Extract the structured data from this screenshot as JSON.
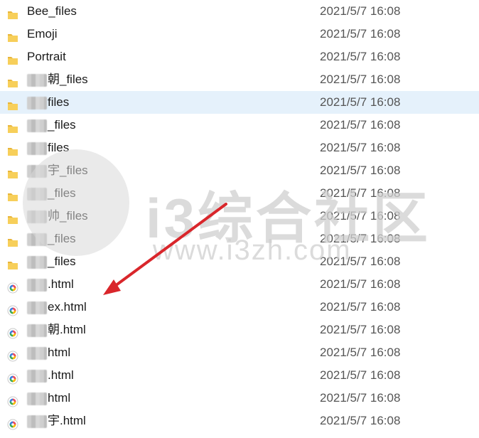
{
  "files": [
    {
      "type": "folder",
      "prefix_mask": 0,
      "name": "Bee_files",
      "date": "2021/5/7 16:08"
    },
    {
      "type": "folder",
      "prefix_mask": 0,
      "name": "Emoji",
      "date": "2021/5/7 16:08"
    },
    {
      "type": "folder",
      "prefix_mask": 0,
      "name": "Portrait",
      "date": "2021/5/7 16:08"
    },
    {
      "type": "folder",
      "prefix_mask": 1,
      "name": "朝_files",
      "date": "2021/5/7 16:08"
    },
    {
      "type": "folder",
      "prefix_mask": 1,
      "name": "files",
      "date": "2021/5/7 16:08",
      "selected": true
    },
    {
      "type": "folder",
      "prefix_mask": 1,
      "name": "_files",
      "date": "2021/5/7 16:08"
    },
    {
      "type": "folder",
      "prefix_mask": 1,
      "name": "files",
      "date": "2021/5/7 16:08"
    },
    {
      "type": "folder",
      "prefix_mask": 1,
      "name": "宇_files",
      "date": "2021/5/7 16:08"
    },
    {
      "type": "folder",
      "prefix_mask": 1,
      "name": "_files",
      "date": "2021/5/7 16:08"
    },
    {
      "type": "folder",
      "prefix_mask": 1,
      "name": "帅_files",
      "date": "2021/5/7 16:08"
    },
    {
      "type": "folder",
      "prefix_mask": 1,
      "name": "_files",
      "date": "2021/5/7 16:08"
    },
    {
      "type": "folder",
      "prefix_mask": 1,
      "name": "_files",
      "date": "2021/5/7 16:08"
    },
    {
      "type": "html",
      "prefix_mask": 1,
      "name": ".html",
      "date": "2021/5/7 16:08"
    },
    {
      "type": "html",
      "prefix_mask": 1,
      "name": "ex.html",
      "date": "2021/5/7 16:08"
    },
    {
      "type": "html",
      "prefix_mask": 1,
      "name": "朝.html",
      "date": "2021/5/7 16:08"
    },
    {
      "type": "html",
      "prefix_mask": 1,
      "name": "html",
      "date": "2021/5/7 16:08"
    },
    {
      "type": "html",
      "prefix_mask": 1,
      "name": ".html",
      "date": "2021/5/7 16:08"
    },
    {
      "type": "html",
      "prefix_mask": 1,
      "name": "html",
      "date": "2021/5/7 16:08"
    },
    {
      "type": "html",
      "prefix_mask": 1,
      "name": "宇.html",
      "date": "2021/5/7 16:08"
    }
  ],
  "watermark": {
    "text": "i3综合社区",
    "url": "www.i3zh.com"
  },
  "colors": {
    "selection": "#e5f1fb",
    "folder": "#f4c542",
    "arrow": "#d9262b"
  },
  "icons": {
    "folder": "folder-icon",
    "html": "html-file-icon"
  }
}
